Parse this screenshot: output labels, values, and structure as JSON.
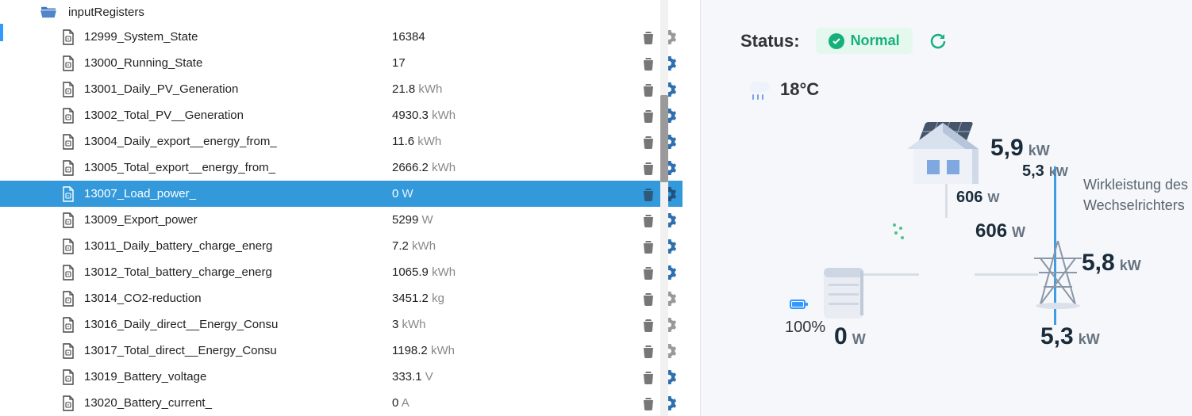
{
  "folder": {
    "name": "inputRegisters"
  },
  "rows": [
    {
      "name": "12999_System_State",
      "value": "16384",
      "unit": "",
      "gearActive": false,
      "selected": false
    },
    {
      "name": "13000_Running_State",
      "value": "17",
      "unit": "",
      "gearActive": true,
      "selected": false
    },
    {
      "name": "13001_Daily_PV_Generation",
      "value": "21.8",
      "unit": "kWh",
      "gearActive": true,
      "selected": false
    },
    {
      "name": "13002_Total_PV__Generation",
      "value": "4930.3",
      "unit": "kWh",
      "gearActive": true,
      "selected": false
    },
    {
      "name": "13004_Daily_export__energy_from_",
      "value": "11.6",
      "unit": "kWh",
      "gearActive": true,
      "selected": false
    },
    {
      "name": "13005_Total_export__energy_from_",
      "value": "2666.2",
      "unit": "kWh",
      "gearActive": true,
      "selected": false
    },
    {
      "name": "13007_Load_power_",
      "value": "0",
      "unit": "W",
      "gearActive": true,
      "selected": true
    },
    {
      "name": "13009_Export_power",
      "value": "5299",
      "unit": "W",
      "gearActive": true,
      "selected": false
    },
    {
      "name": "13011_Daily_battery_charge_energ",
      "value": "7.2",
      "unit": "kWh",
      "gearActive": true,
      "selected": false
    },
    {
      "name": "13012_Total_battery_charge_energ",
      "value": "1065.9",
      "unit": "kWh",
      "gearActive": true,
      "selected": false
    },
    {
      "name": "13014_CO2-reduction",
      "value": "3451.2",
      "unit": "kg",
      "gearActive": false,
      "selected": false
    },
    {
      "name": "13016_Daily_direct__Energy_Consu",
      "value": "3",
      "unit": "kWh",
      "gearActive": false,
      "selected": false
    },
    {
      "name": "13017_Total_direct__Energy_Consu",
      "value": "1198.2",
      "unit": "kWh",
      "gearActive": false,
      "selected": false
    },
    {
      "name": "13019_Battery_voltage",
      "value": "333.1",
      "unit": "V",
      "gearActive": true,
      "selected": false
    },
    {
      "name": "13020_Battery_current_",
      "value": "0",
      "unit": "A",
      "gearActive": true,
      "selected": false
    }
  ],
  "status": {
    "label": "Status:",
    "badge": "Normal"
  },
  "temperature": "18°C",
  "diagram": {
    "pv": {
      "value": "5,9",
      "unit": "kW"
    },
    "pv_sub": {
      "value": "5,3",
      "unit": "kW"
    },
    "flow_top": {
      "value": "606",
      "unit": "W"
    },
    "house": {
      "value": "606",
      "unit": "W"
    },
    "grid": {
      "value": "5,8",
      "unit": "kW"
    },
    "grid_sub": {
      "value": "5,3",
      "unit": "kW"
    },
    "battery": {
      "value": "0",
      "unit": "W"
    },
    "battery_pct": "100%",
    "caption": "Wirkleistung des Wechselrichters"
  }
}
